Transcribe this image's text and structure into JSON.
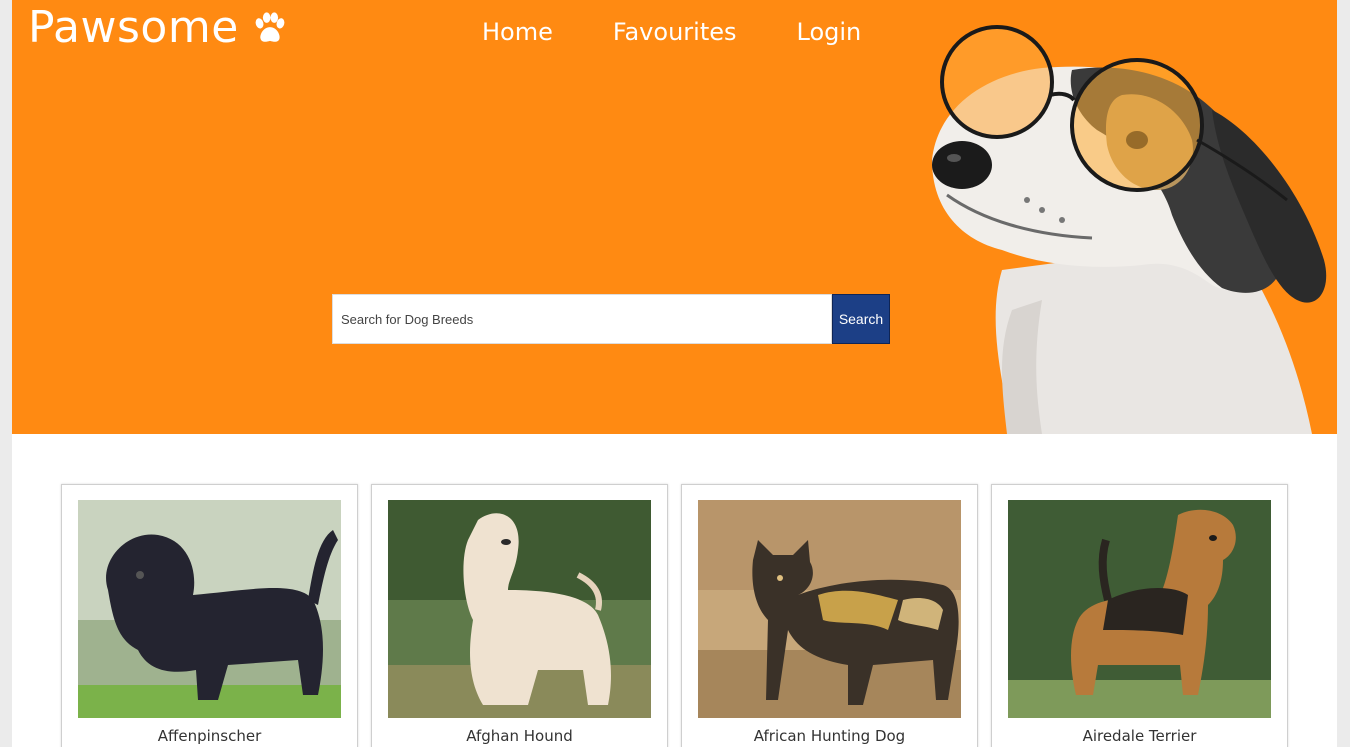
{
  "brand": {
    "name": "Pawsome",
    "icon": "paw-icon",
    "color": "#ff8a12"
  },
  "nav": {
    "items": [
      "Home",
      "Favourites",
      "Login"
    ]
  },
  "search": {
    "placeholder": "Search for Dog Breeds",
    "value": "",
    "button_label": "Search",
    "button_color": "#1c3f86"
  },
  "hero": {
    "image": "dog-with-sunglasses"
  },
  "breeds": [
    {
      "name": "Affenpinscher",
      "image": "affenpinscher-photo"
    },
    {
      "name": "Afghan Hound",
      "image": "afghan-hound-photo"
    },
    {
      "name": "African Hunting Dog",
      "image": "african-hunting-dog-photo"
    },
    {
      "name": "Airedale Terrier",
      "image": "airedale-terrier-photo"
    }
  ]
}
